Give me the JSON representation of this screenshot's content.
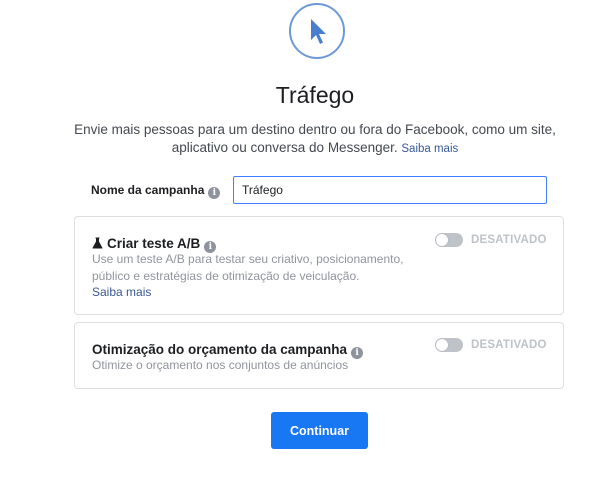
{
  "header": {
    "icon": "cursor-arrow-icon",
    "title": "Tráfego",
    "description": "Envie mais pessoas para um destino dentro ou fora do Facebook, como um site, aplicativo ou conversa do Messenger.",
    "learn_more": "Saiba mais"
  },
  "campaign_name": {
    "label": "Nome da campanha",
    "value": "Tráfego"
  },
  "ab_test": {
    "title": "Criar teste A/B",
    "description": "Use um teste A/B para testar seu criativo, posicionamento, público e estratégias de otimização de veiculação.",
    "learn_more": "Saiba mais",
    "toggle_state": "DESATIVADO"
  },
  "budget_optimization": {
    "title": "Otimização do orçamento da campanha",
    "description": "Otimize o orçamento nos conjuntos de anúncios",
    "toggle_state": "DESATIVADO"
  },
  "footer": {
    "continue_label": "Continuar"
  },
  "colors": {
    "accent": "#1877f2",
    "icon_ring": "#6d9ad6",
    "cursor": "#4a7fd0"
  }
}
